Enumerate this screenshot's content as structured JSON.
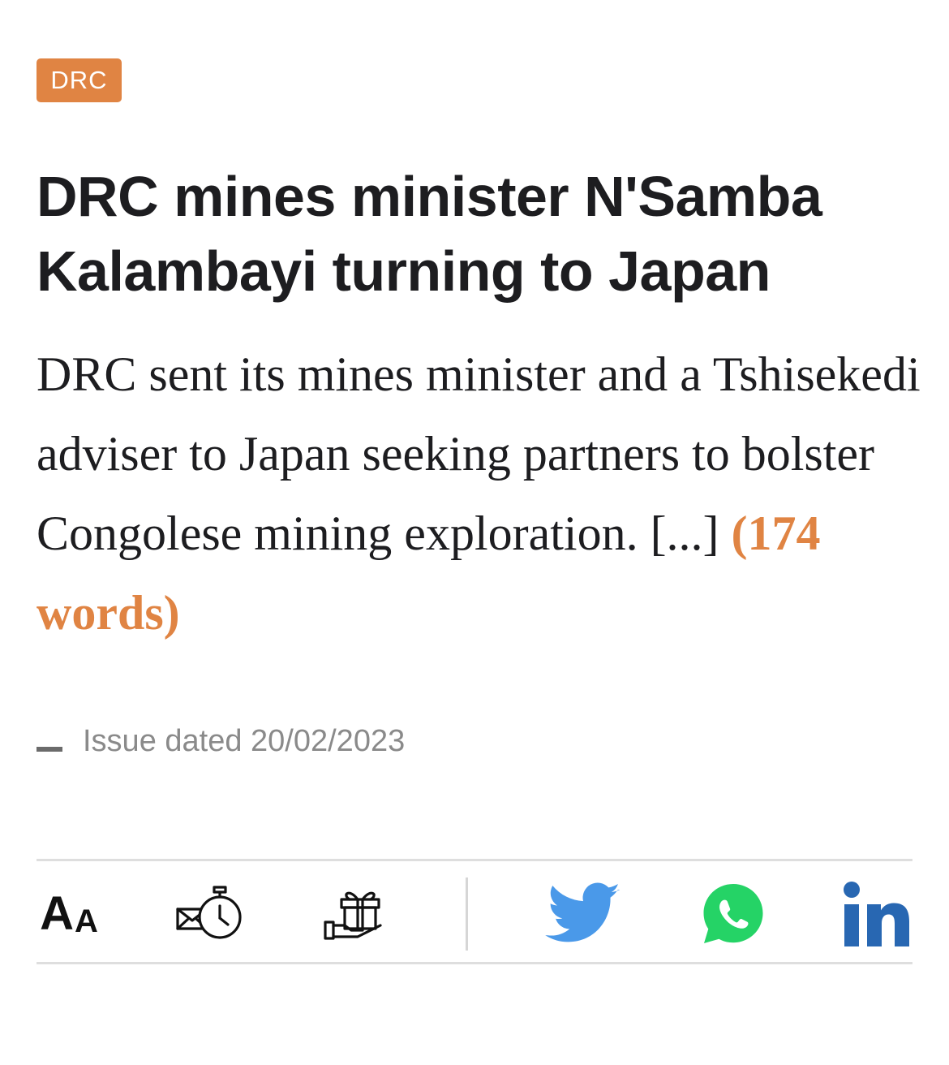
{
  "article": {
    "category_tag": "DRC",
    "headline": "DRC mines minister N'Samba Kalambayi turning to Japan",
    "summary": "DRC sent its mines minister and a Tshisekedi adviser to Japan seeking partners to bolster Congolese mining exploration. [...] ",
    "word_count": "(174 words)",
    "issue_date": "Issue dated 20/02/2023"
  },
  "toolbar": {
    "font_size_big": "A",
    "font_size_small": "A",
    "items": [
      {
        "name": "font-size",
        "icon": "font-size-icon"
      },
      {
        "name": "read-later",
        "icon": "mail-clock-icon"
      },
      {
        "name": "gift-article",
        "icon": "gift-hand-icon"
      },
      {
        "name": "share-twitter",
        "icon": "twitter-icon"
      },
      {
        "name": "share-whatsapp",
        "icon": "whatsapp-icon"
      },
      {
        "name": "share-linkedin",
        "icon": "linkedin-icon"
      }
    ]
  },
  "colors": {
    "accent": "#e08443",
    "text": "#1d1d20",
    "muted": "#8a8a8a",
    "twitter": "#4a99e9",
    "whatsapp": "#25d366",
    "linkedin": "#2867b2"
  }
}
